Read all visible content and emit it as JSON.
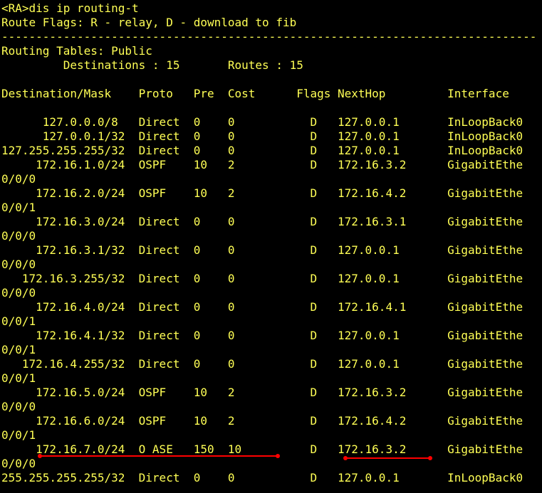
{
  "terminal": {
    "prompt_command": "<RA>dis ip routing-t",
    "flags_line": "Route Flags: R - relay, D - download to fib",
    "separator": "------------------------------------------------------------------------------",
    "tables_title": "Routing Tables: Public",
    "summary_line": "         Destinations : 15       Routes : 15",
    "header": "Destination/Mask    Proto   Pre  Cost      Flags NextHop         Interface",
    "rows": [
      "      127.0.0.0/8   Direct  0    0           D   127.0.0.1       InLoopBack0",
      "      127.0.0.1/32  Direct  0    0           D   127.0.0.1       InLoopBack0",
      "127.255.255.255/32  Direct  0    0           D   127.0.0.1       InLoopBack0",
      "     172.16.1.0/24  OSPF    10   2           D   172.16.3.2      GigabitEthe",
      "0/0/0",
      "     172.16.2.0/24  OSPF    10   2           D   172.16.4.2      GigabitEthe",
      "0/0/1",
      "     172.16.3.0/24  Direct  0    0           D   172.16.3.1      GigabitEthe",
      "0/0/0",
      "     172.16.3.1/32  Direct  0    0           D   127.0.0.1       GigabitEthe",
      "0/0/0",
      "   172.16.3.255/32  Direct  0    0           D   127.0.0.1       GigabitEthe",
      "0/0/0",
      "     172.16.4.0/24  Direct  0    0           D   172.16.4.1      GigabitEthe",
      "0/0/1",
      "     172.16.4.1/32  Direct  0    0           D   127.0.0.1       GigabitEthe",
      "0/0/1",
      "   172.16.4.255/32  Direct  0    0           D   127.0.0.1       GigabitEthe",
      "0/0/1",
      "     172.16.5.0/24  OSPF    10   2           D   172.16.3.2      GigabitEthe",
      "0/0/0",
      "     172.16.6.0/24  OSPF    10   2           D   172.16.4.2      GigabitEthe",
      "0/0/1",
      "     172.16.7.0/24  O_ASE   150  10          D   172.16.3.2      GigabitEthe",
      "0/0/0",
      "255.255.255.255/32  Direct  0    0           D   127.0.0.1       InLoopBack0"
    ]
  },
  "colors": {
    "background": "#000000",
    "text": "#ffff55",
    "annotation": "#ff0000"
  }
}
